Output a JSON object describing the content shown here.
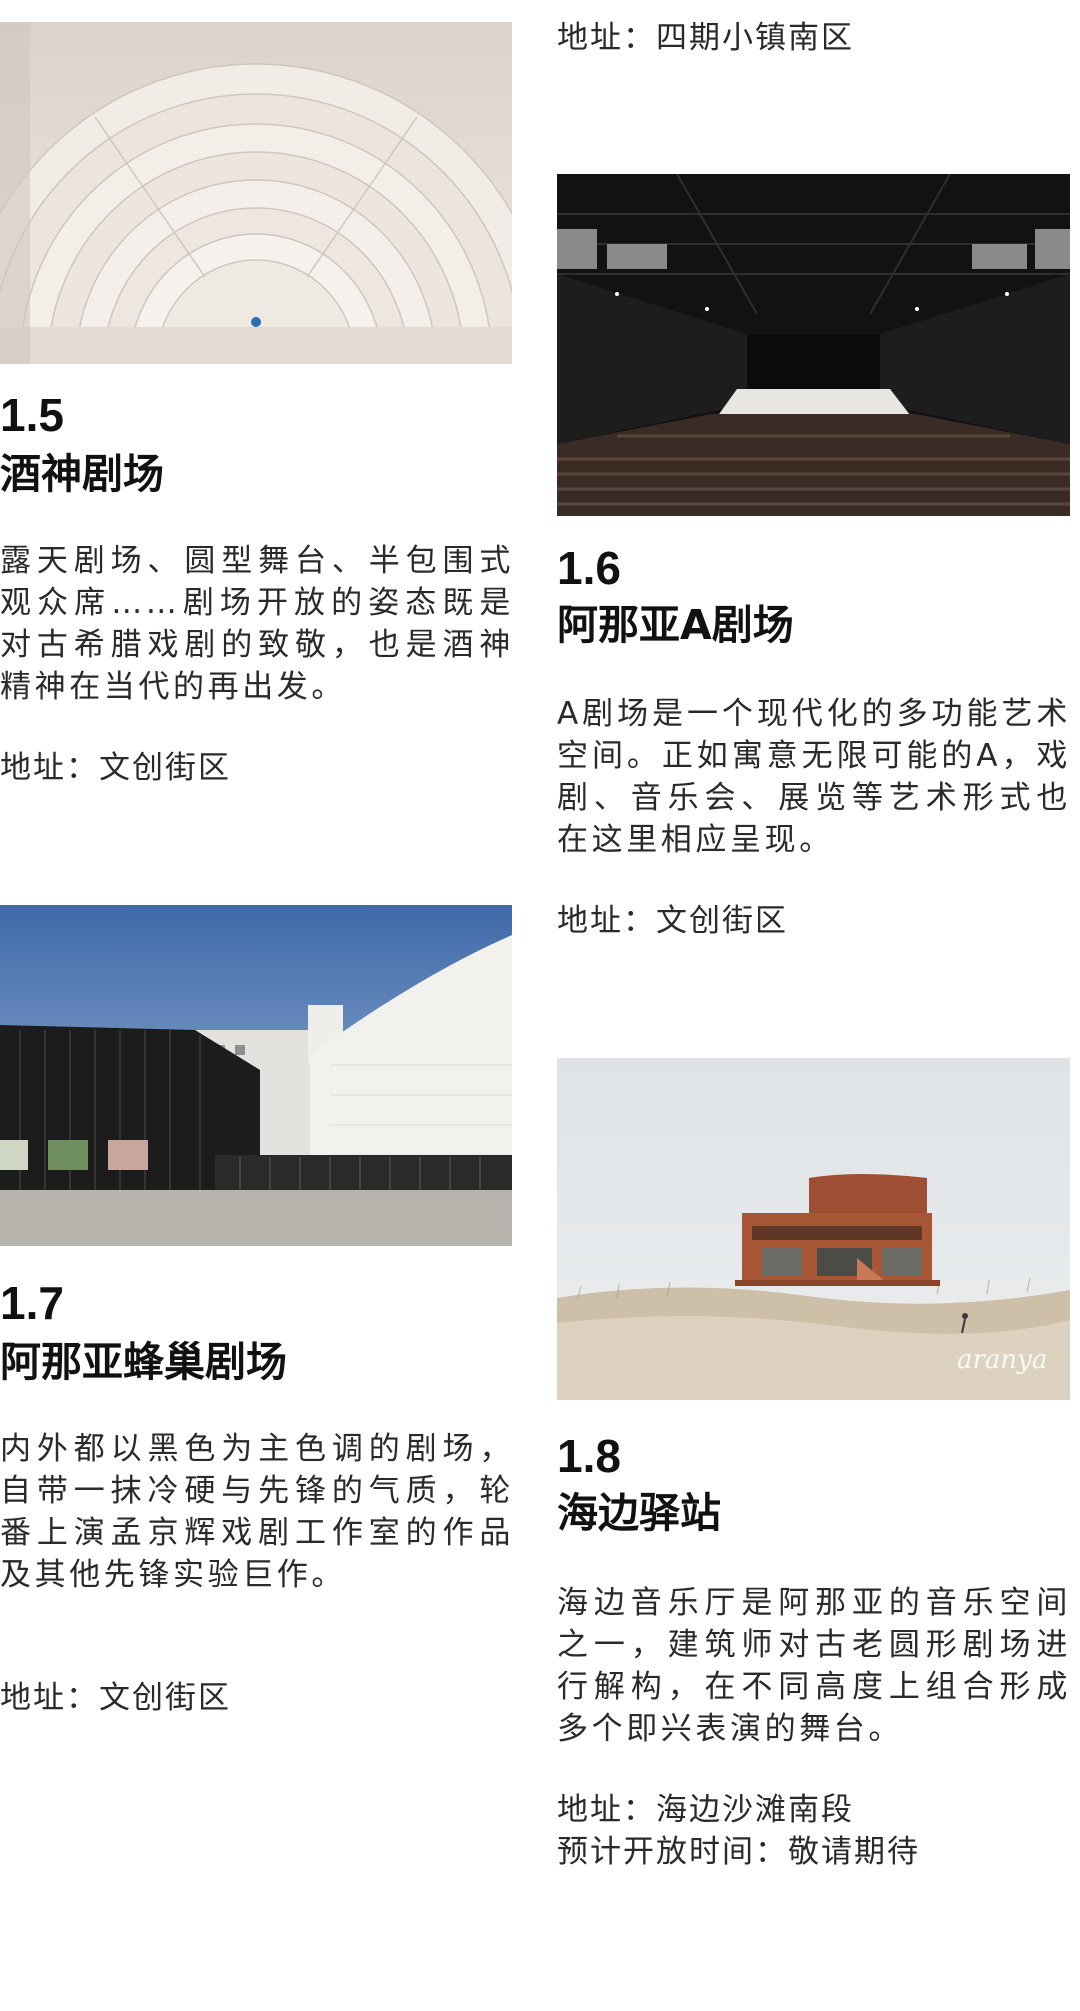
{
  "top_right": {
    "address": "地址：四期小镇南区"
  },
  "venues": {
    "v15": {
      "number": "1.5",
      "title": "酒神剧场",
      "description": "露天剧场、圆型舞台、半包围式观众席……剧场开放的姿态既是对古希腊戏剧的致敬，也是酒神精神在当代的再出发。",
      "address": "地址：文创街区"
    },
    "v16": {
      "number": "1.6",
      "title": "阿那亚A剧场",
      "description": "A剧场是一个现代化的多功能艺术空间。正如寓意无限可能的A，戏剧、音乐会、展览等艺术形式也在这里相应呈现。",
      "address": "地址：文创街区"
    },
    "v17": {
      "number": "1.7",
      "title": "阿那亚蜂巢剧场",
      "description": "内外都以黑色为主色调的剧场，自带一抹冷硬与先锋的气质，轮番上演孟京辉戏剧工作室的作品及其他先锋实验巨作。",
      "address": "地址：文创街区"
    },
    "v18": {
      "number": "1.8",
      "title": "海边驿站",
      "description": "海边音乐厅是阿那亚的音乐空间之一，建筑师对古老圆形剧场进行解构，在不同高度上组合形成多个即兴表演的舞台。",
      "address": "地址：海边沙滩南段",
      "opening": "预计开放时间：敬请期待"
    }
  },
  "photo_text": {
    "brand_watermark": "aranya"
  },
  "colors": {
    "text": "#1b1b1b",
    "background": "#ffffff"
  }
}
